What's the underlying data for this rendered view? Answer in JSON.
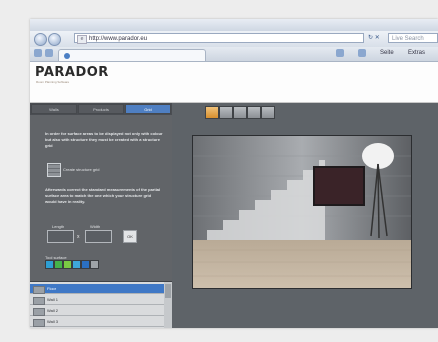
{
  "browser": {
    "address": "http://www.parador.eu",
    "search_placeholder": "Live Search",
    "tab_title": "",
    "page_menu": "Seite",
    "tools_menu": "Extras"
  },
  "site": {
    "logo": "PARADOR",
    "tagline": "Room Planning Software"
  },
  "left_tabs": [
    {
      "label": "Walls"
    },
    {
      "label": "Products"
    },
    {
      "label": "Grid"
    }
  ],
  "panel": {
    "intro": "In order for surface areas to be displayed not only with colour but also with structure they must be created with a structure grid",
    "create_grid_label": "Create structure grid",
    "after": "Afterwards correct the standard measurements of the partial surface area to match the one which your structure grid would have in reality.",
    "length_label": "Length",
    "width_label": "Width",
    "times": "x",
    "ok_label": "OK",
    "tool_label": "Tool surface"
  },
  "surfaces": [
    {
      "label": "Floor"
    },
    {
      "label": "Wall 1"
    },
    {
      "label": "Wall 2"
    },
    {
      "label": "Wall 3"
    }
  ],
  "colors": {
    "accent": "#3f78c6",
    "panel": "#616468",
    "swatch_1": "#2e9fd4",
    "swatch_2": "#45b34a",
    "swatch_3": "#7ac943",
    "swatch_4": "#3ea7d8",
    "swatch_5": "#2b6fc1"
  }
}
